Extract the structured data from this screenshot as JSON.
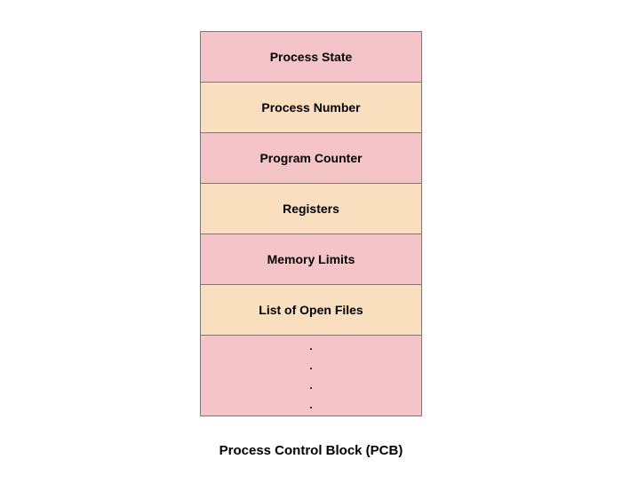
{
  "rows": [
    {
      "label": "Process State",
      "color": "pink"
    },
    {
      "label": "Process Number",
      "color": "peach"
    },
    {
      "label": "Program Counter",
      "color": "pink"
    },
    {
      "label": "Registers",
      "color": "peach"
    },
    {
      "label": "Memory Limits",
      "color": "pink"
    },
    {
      "label": "List of Open Files",
      "color": "peach"
    }
  ],
  "dots": [
    ".",
    ".",
    ".",
    "."
  ],
  "caption": "Process Control Block (PCB)"
}
